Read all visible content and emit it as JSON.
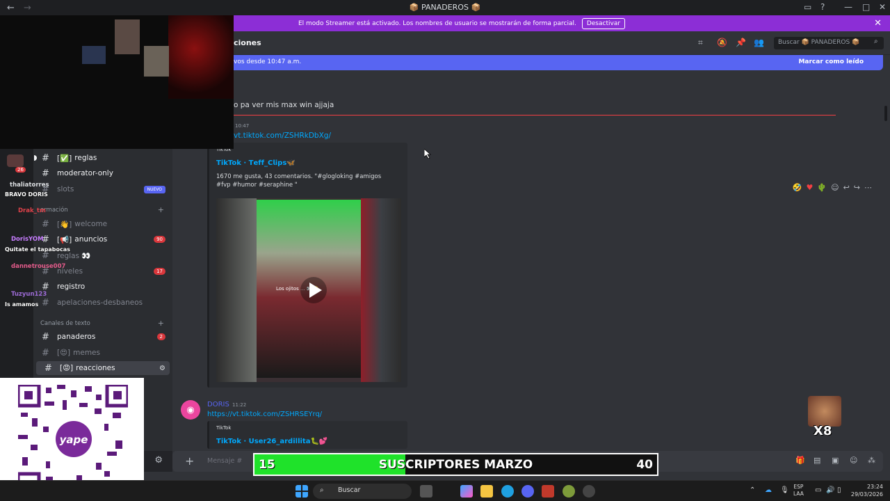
{
  "window": {
    "title": "📦 PANADEROS 📦",
    "back": "←",
    "forward": "→"
  },
  "banner": {
    "text": "El modo Streamer está activado. Los nombres de usuario se mostrarán de forma parcial.",
    "button": "Desactivar"
  },
  "header": {
    "channel": "ciones",
    "search_placeholder": "Buscar 📦 PANADEROS 📦"
  },
  "newbar": {
    "left": "vos desde 10:47 a.m.",
    "right": "Marcar como leído"
  },
  "channels": {
    "items": [
      {
        "prefix": "[✅]",
        "label": "reglas",
        "unread": true
      },
      {
        "prefix": "",
        "label": "moderator-only",
        "unread": true
      },
      {
        "prefix": "",
        "label": "slots",
        "badge": "NUEVO"
      },
      {
        "prefix": "[👋]",
        "label": "welcome"
      },
      {
        "prefix": "[📢]",
        "label": "anuncios",
        "unread": true,
        "badge": "90"
      },
      {
        "prefix": "",
        "label": "reglas 👀"
      },
      {
        "prefix": "",
        "label": "niveles",
        "badge": "17"
      },
      {
        "prefix": "",
        "label": "registro",
        "unread": true
      },
      {
        "prefix": "",
        "label": "apelaciones-desbaneos"
      },
      {
        "prefix": "",
        "label": "panaderos",
        "unread": true,
        "badge": "2"
      },
      {
        "prefix": "[😍]",
        "label": "memes"
      },
      {
        "prefix": "[😡]",
        "label": "reacciones",
        "unread": true
      }
    ],
    "cat_info": "ormación",
    "cat_text": "Canales de texto"
  },
  "messages": {
    "line1": "o pa ver mis max win ajjaja",
    "time1": "10:47",
    "link1": "vt.tiktok.com/ZSHRkDbXg/",
    "embed1": {
      "provider": "TikTok",
      "title": "TikTok · 𝗧𝗲𝗳𝗳_𝗖𝗹𝗶𝗽𝘀🦋",
      "desc": "1670 me gusta, 43 comentarios. \"#glogloking #amigos #fvp #humor #seraphine \"",
      "overlay": "Los ojitos ... 👀🥺"
    },
    "user2": "DORIS",
    "time2": "11:22",
    "link2": "https://vt.tiktok.com/ZSHRSEYrq/",
    "embed2": {
      "provider": "TikTok",
      "title": "TikTok · User26_ardillita🐛💕"
    }
  },
  "composer": {
    "placeholder": "Mensaje #"
  },
  "chat_overlay": [
    {
      "name": "thaliatorres",
      "msg": "BRAVO DORIS",
      "color": "#f2f3f5"
    },
    {
      "name": "Drak_tm",
      "msg": "",
      "color": "#e0424a"
    },
    {
      "name": "DorisYOM",
      "msg": "Quitate el tapabocas",
      "color": "#c77dff"
    },
    {
      "name": "dannetrouse007",
      "msg": "",
      "color": "#e35b8a"
    },
    {
      "name": "Tuzyun123",
      "msg": "Is amamos",
      "color": "#9d6bd6"
    }
  ],
  "subs": {
    "current": "15",
    "label": "SUSCRIPTORES MARZO",
    "goal": "40",
    "progress": 0.375
  },
  "sticker": {
    "text": "X8"
  },
  "taskbar": {
    "search": "Buscar",
    "lang": "ESP",
    "lang2": "LAA",
    "time": "23:24",
    "date": "29/03/2026"
  },
  "rail_badge": "26"
}
